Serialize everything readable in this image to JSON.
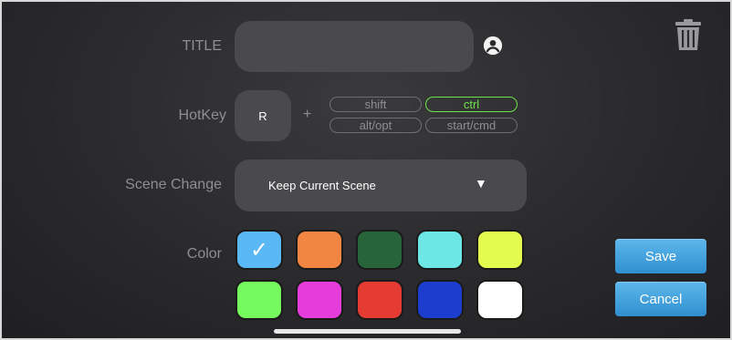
{
  "form": {
    "title_label": "TITLE",
    "title_value": "",
    "hotkey_label": "HotKey",
    "hotkey_key": "R",
    "plus": "+",
    "modifiers": [
      {
        "label": "shift",
        "active": false
      },
      {
        "label": "ctrl",
        "active": true
      },
      {
        "label": "alt/opt",
        "active": false
      },
      {
        "label": "start/cmd",
        "active": false
      }
    ],
    "scene_label": "Scene Change",
    "scene_value": "Keep Current Scene",
    "scene_arrow": "▼",
    "color_label": "Color",
    "colors": [
      "#5ab8f5",
      "#f08642",
      "#27643a",
      "#6de6e6",
      "#e3fb4c",
      "#74fa5c",
      "#e63cdb",
      "#e53b32",
      "#1d3dcf",
      "#ffffff"
    ],
    "selected_color_index": 0,
    "selected_mark": "✓"
  },
  "actions": {
    "save_label": "Save",
    "cancel_label": "Cancel"
  },
  "icons": {
    "account": "account-circle-icon",
    "delete": "trash-icon"
  }
}
